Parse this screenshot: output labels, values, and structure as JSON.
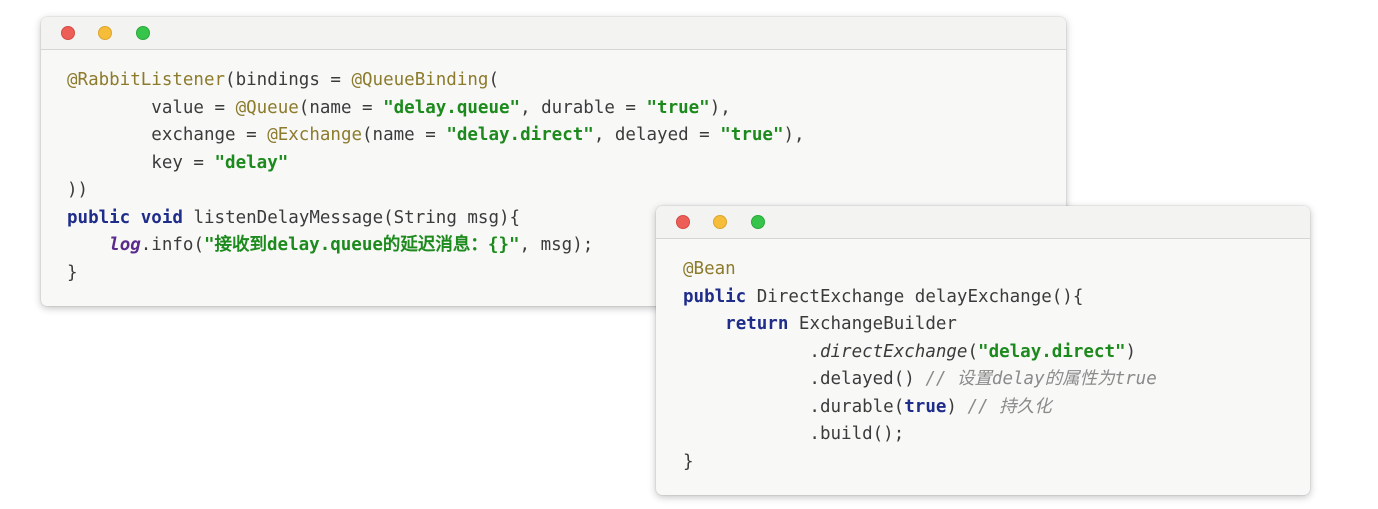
{
  "window1": {
    "lines": [
      [
        {
          "t": "@RabbitListener",
          "c": "ann"
        },
        {
          "t": "(bindings = "
        },
        {
          "t": "@QueueBinding",
          "c": "ann"
        },
        {
          "t": "("
        }
      ],
      [
        {
          "t": "        value = "
        },
        {
          "t": "@Queue",
          "c": "ann"
        },
        {
          "t": "(name = "
        },
        {
          "t": "\"delay.queue\"",
          "c": "str"
        },
        {
          "t": ", durable = "
        },
        {
          "t": "\"true\"",
          "c": "str"
        },
        {
          "t": "),"
        }
      ],
      [
        {
          "t": "        exchange = "
        },
        {
          "t": "@Exchange",
          "c": "ann"
        },
        {
          "t": "(name = "
        },
        {
          "t": "\"delay.direct\"",
          "c": "str"
        },
        {
          "t": ", delayed = "
        },
        {
          "t": "\"true\"",
          "c": "str"
        },
        {
          "t": "),"
        }
      ],
      [
        {
          "t": "        key = "
        },
        {
          "t": "\"delay\"",
          "c": "str"
        }
      ],
      [
        {
          "t": "))"
        }
      ],
      [
        {
          "t": "public",
          "c": "kw"
        },
        {
          "t": " "
        },
        {
          "t": "void",
          "c": "kw"
        },
        {
          "t": " listenDelayMessage(String msg){"
        }
      ],
      [
        {
          "t": "    "
        },
        {
          "t": "log",
          "c": "field"
        },
        {
          "t": ".info("
        },
        {
          "t": "\"接收到delay.queue的延迟消息：{}\"",
          "c": "str"
        },
        {
          "t": ", msg);"
        }
      ],
      [
        {
          "t": "}"
        }
      ]
    ]
  },
  "window2": {
    "lines": [
      [
        {
          "t": "@Bean",
          "c": "ann"
        }
      ],
      [
        {
          "t": "public",
          "c": "kw"
        },
        {
          "t": " DirectExchange delayExchange(){"
        }
      ],
      [
        {
          "t": "    "
        },
        {
          "t": "return",
          "c": "kw"
        },
        {
          "t": " ExchangeBuilder"
        }
      ],
      [
        {
          "t": "            ."
        },
        {
          "t": "directExchange",
          "c": "ital"
        },
        {
          "t": "("
        },
        {
          "t": "\"delay.direct\"",
          "c": "str"
        },
        {
          "t": ")"
        }
      ],
      [
        {
          "t": "            .delayed() "
        },
        {
          "t": "// 设置delay的属性为true",
          "c": "cmt"
        }
      ],
      [
        {
          "t": "            .durable("
        },
        {
          "t": "true",
          "c": "kw"
        },
        {
          "t": ") "
        },
        {
          "t": "// 持久化",
          "c": "cmt"
        }
      ],
      [
        {
          "t": "            .build();"
        }
      ],
      [
        {
          "t": "}"
        }
      ]
    ]
  }
}
